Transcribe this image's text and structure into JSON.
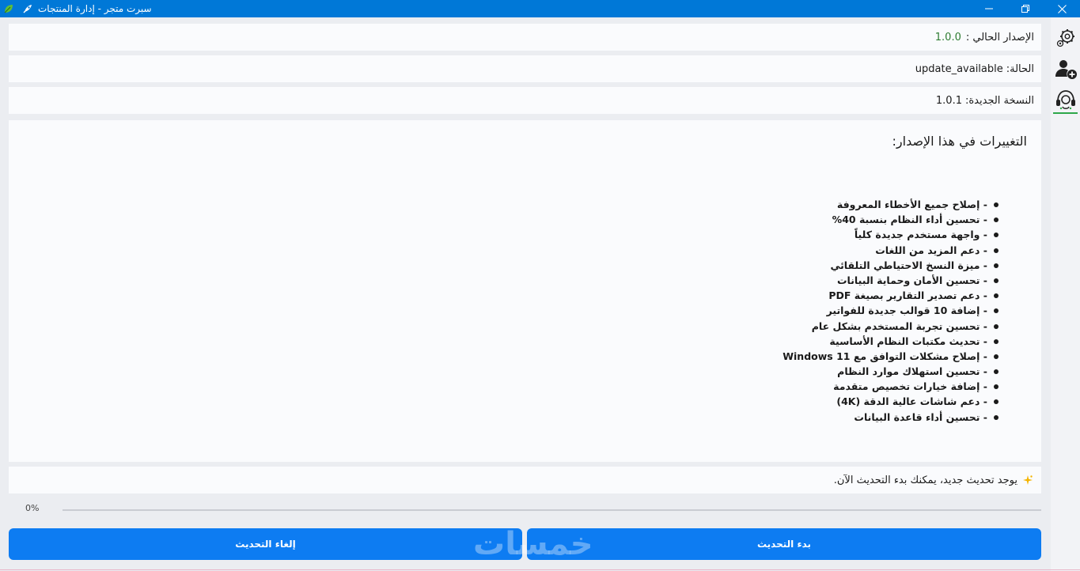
{
  "window": {
    "title": "سبرت متجر - إدارة المنتجات"
  },
  "info": {
    "version_label": "الإصدار الحالي :",
    "version_value": "1.0.0",
    "status_label": "الحالة:",
    "status_value": "update_available",
    "new_version_label": "النسخة الجديدة:",
    "new_version_value": "1.0.1"
  },
  "changes": {
    "title": "التغييرات في هذا الإصدار:",
    "items": [
      "- إصلاح جميع الأخطاء المعروفة",
      "- تحسين أداء النظام بنسبة 40%",
      "- واجهة مستخدم جديدة كلياً",
      "- دعم المزيد من اللغات",
      "- ميزة النسخ الاحتياطي التلقائي",
      "- تحسين الأمان وحماية البيانات",
      "- دعم تصدير التقارير بصيغة PDF",
      "- إضافة 10 قوالب جديدة للفواتير",
      "- تحسين تجربة المستخدم بشكل عام",
      "- تحديث مكتبات النظام الأساسية",
      "- إصلاح مشكلات التوافق مع Windows 11",
      "- تحسين استهلاك موارد النظام",
      "- إضافة خيارات تخصيص متقدمة",
      "- دعم شاشات عالية الدقة (4K)",
      "- تحسين أداء قاعدة البيانات"
    ]
  },
  "notice": {
    "icon": "sparkle-icon",
    "text": "يوجد تحديث جديد، يمكنك بدء التحديث الآن."
  },
  "progress": {
    "label": "0%",
    "value": 0
  },
  "buttons": {
    "cancel": "إلغاء التحديث",
    "start": "بدء التحديث"
  },
  "watermark": "خمسات",
  "colors": {
    "titlebar": "#0078d7",
    "button": "#0d7cf2",
    "version_value": "#2e7d32",
    "active_indicator": "#2ea84a"
  },
  "sidebar": {
    "items": [
      "settings-gear-icon",
      "add-user-icon",
      "support-headset-icon"
    ]
  }
}
